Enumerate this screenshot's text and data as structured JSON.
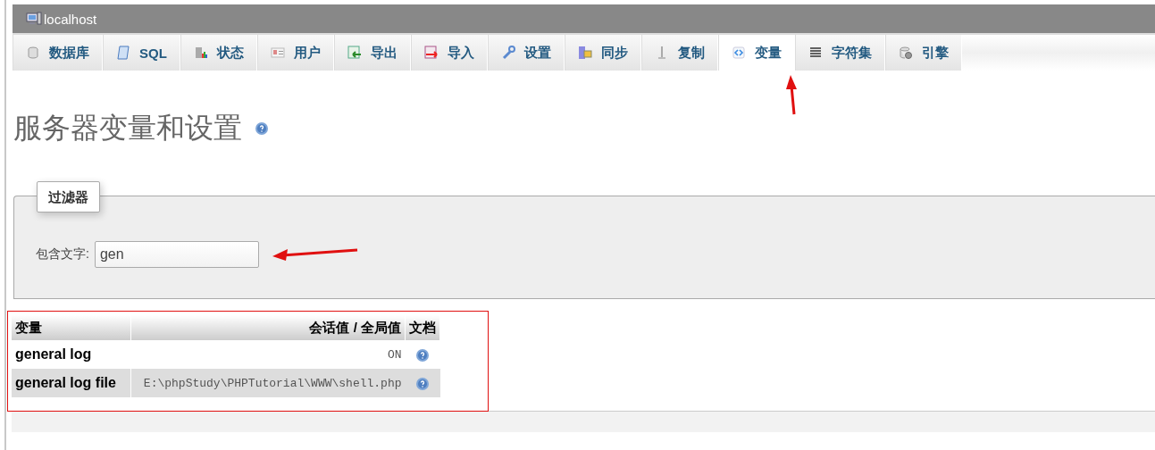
{
  "server": {
    "title": "localhost"
  },
  "tabs": [
    {
      "label": "数据库",
      "selected": false
    },
    {
      "label": "SQL",
      "selected": false
    },
    {
      "label": "状态",
      "selected": false
    },
    {
      "label": "用户",
      "selected": false
    },
    {
      "label": "导出",
      "selected": false
    },
    {
      "label": "导入",
      "selected": false
    },
    {
      "label": "设置",
      "selected": false
    },
    {
      "label": "同步",
      "selected": false
    },
    {
      "label": "复制",
      "selected": false
    },
    {
      "label": "变量",
      "selected": true
    },
    {
      "label": "字符集",
      "selected": false
    },
    {
      "label": "引擎",
      "selected": false
    }
  ],
  "heading": "服务器变量和设置",
  "filter": {
    "legend": "过滤器",
    "label": "包含文字:",
    "value": "gen"
  },
  "table": {
    "columns": [
      "变量",
      "会话值 / 全局值",
      "文档"
    ],
    "rows": [
      {
        "name": "general log",
        "value": "ON"
      },
      {
        "name": "general log file",
        "value": "E:\\phpStudy\\PHPTutorial\\WWW\\shell.php"
      }
    ]
  }
}
